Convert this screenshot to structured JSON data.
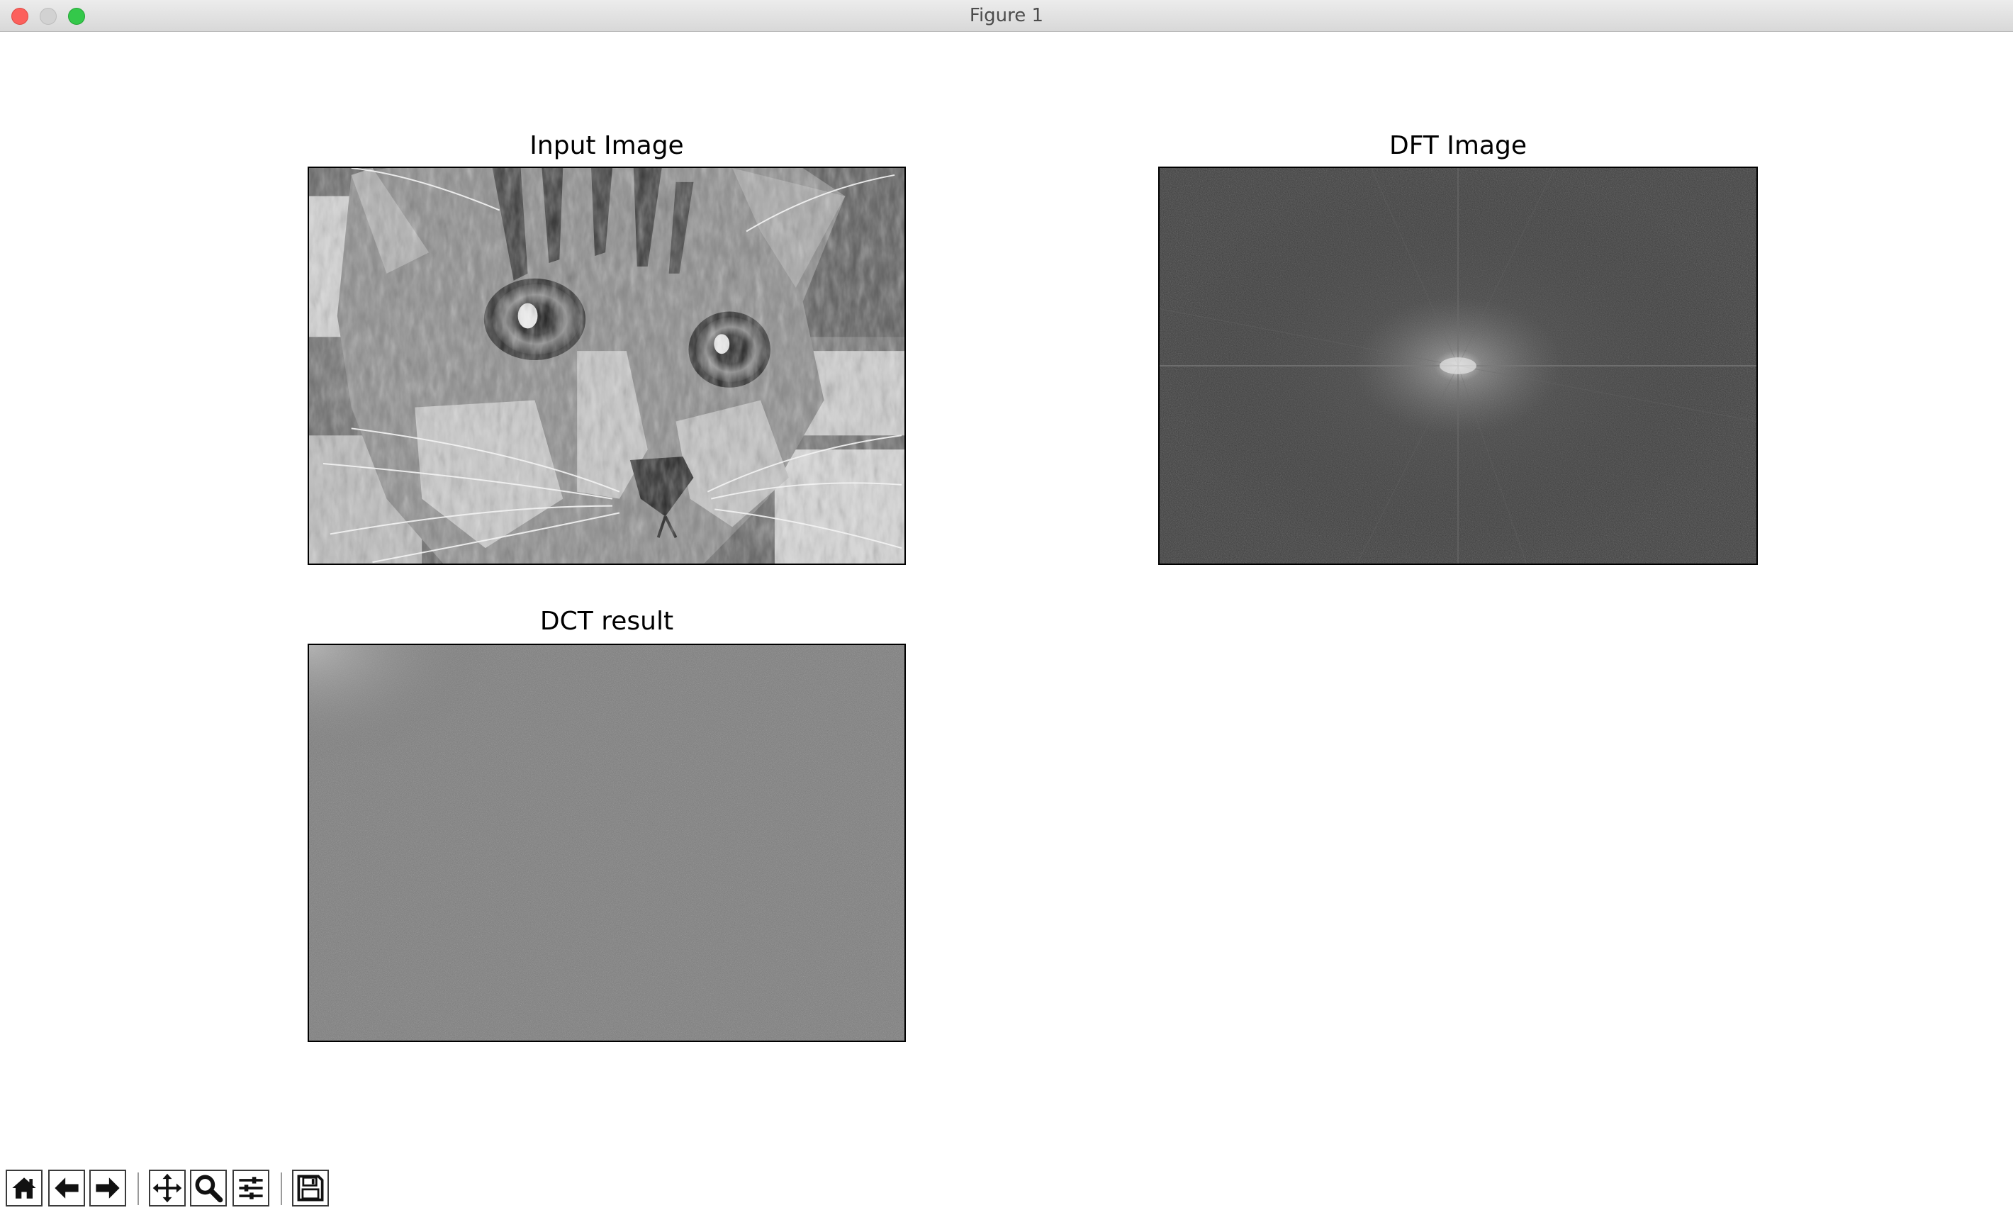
{
  "window": {
    "title": "Figure 1"
  },
  "subplots": [
    {
      "title": "Input Image"
    },
    {
      "title": "DFT Image"
    },
    {
      "title": "DCT result"
    }
  ],
  "toolbar": {
    "buttons": [
      {
        "icon": "home-icon"
      },
      {
        "icon": "back-arrow-icon"
      },
      {
        "icon": "forward-arrow-icon"
      },
      {
        "icon": "pan-icon"
      },
      {
        "icon": "zoom-icon"
      },
      {
        "icon": "configure-subplots-icon"
      },
      {
        "icon": "save-icon"
      }
    ]
  },
  "colors": {
    "titlebar": "#e3e3e3",
    "close": "#fc605c",
    "minimize": "#d2d2d2",
    "maximize": "#34c84a",
    "dft_background": "#3c3c3c",
    "dct_background": "#7a7a7a"
  }
}
